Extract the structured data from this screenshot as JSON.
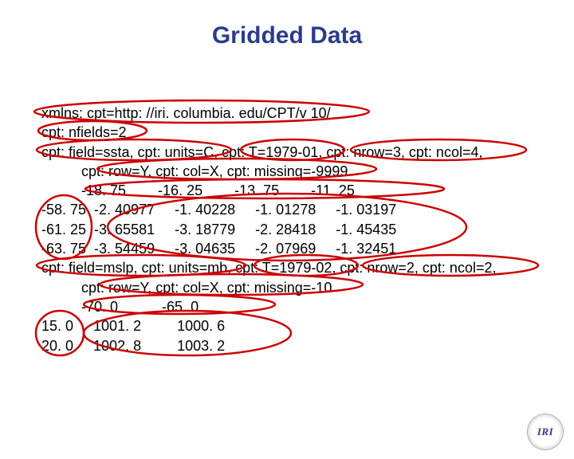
{
  "title": "Gridded Data",
  "lines": [
    "xmlns: cpt=http: //iri. columbia. edu/CPT/v 10/",
    "cpt: nfields=2",
    "cpt: field=ssta, cpt: units=C, cpt: T=1979-01, cpt: nrow=3, cpt: ncol=4,",
    "          cpt: row=Y, cpt: col=X, cpt: missing=-9999",
    "          -18. 75        -16. 25        -13. 75        -11. 25",
    "-58. 75  -2. 40977     -1. 40228     -1. 01278     -1. 03197",
    "-61. 25  -3. 65581     -3. 18779     -2. 28418     -1. 45435",
    "-63. 75  -3. 54459     -3. 04635     -2. 07969     -1. 32451",
    "cpt: field=mslp, cpt: units=mb, cpt: T=1979-02, cpt: nrow=2, cpt: ncol=2,",
    "          cpt: row=Y, cpt: col=X, cpt: missing=-10",
    "          -70. 0           -65. 0",
    "15. 0     1001. 2         1000. 6",
    "20. 0     1002. 8         1003. 2"
  ],
  "logo_text": "IRI"
}
